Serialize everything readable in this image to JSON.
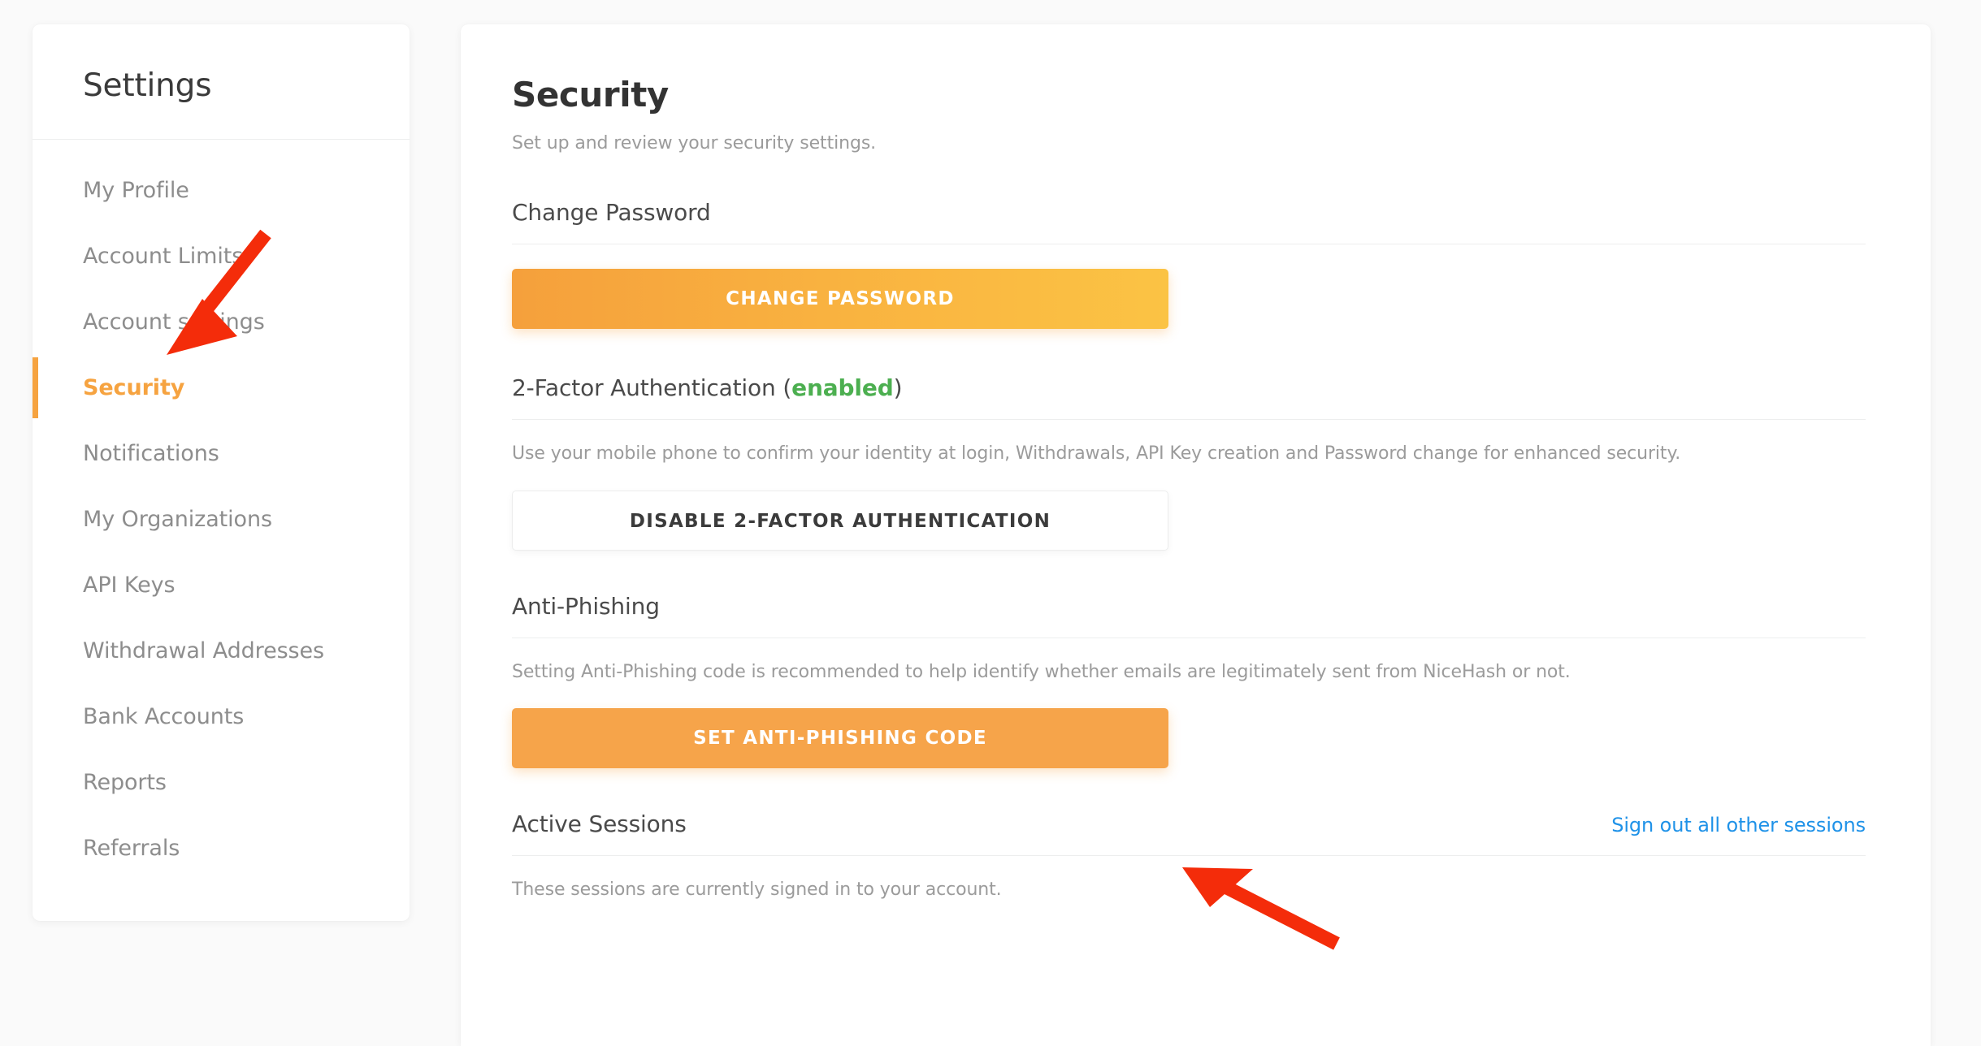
{
  "sidebar": {
    "title": "Settings",
    "items": [
      {
        "label": "My Profile",
        "active": false
      },
      {
        "label": "Account Limits",
        "active": false
      },
      {
        "label": "Account settings",
        "active": false
      },
      {
        "label": "Security",
        "active": true
      },
      {
        "label": "Notifications",
        "active": false
      },
      {
        "label": "My Organizations",
        "active": false
      },
      {
        "label": "API Keys",
        "active": false
      },
      {
        "label": "Withdrawal Addresses",
        "active": false
      },
      {
        "label": "Bank Accounts",
        "active": false
      },
      {
        "label": "Reports",
        "active": false
      },
      {
        "label": "Referrals",
        "active": false
      }
    ]
  },
  "main": {
    "title": "Security",
    "subtitle": "Set up and review your security settings.",
    "sections": {
      "change_password": {
        "heading": "Change Password",
        "button_label": "CHANGE PASSWORD"
      },
      "two_factor": {
        "heading_prefix": "2-Factor Authentication (",
        "status": "enabled",
        "heading_suffix": ")",
        "description": "Use your mobile phone to confirm your identity at login, Withdrawals, API Key creation and Password change for enhanced security.",
        "button_label": "DISABLE 2-FACTOR AUTHENTICATION"
      },
      "anti_phishing": {
        "heading": "Anti-Phishing",
        "description": "Setting Anti-Phishing code is recommended to help identify whether emails are legitimately sent from NiceHash or not.",
        "button_label": "SET ANTI-PHISHING CODE"
      },
      "active_sessions": {
        "heading": "Active Sessions",
        "link_label": "Sign out all other sessions",
        "description": "These sessions are currently signed in to your account."
      }
    }
  },
  "colors": {
    "accent_orange": "#f6a340",
    "status_green": "#4caf50",
    "link_blue": "#1f92e8",
    "annotation_red": "#f42c0a"
  }
}
